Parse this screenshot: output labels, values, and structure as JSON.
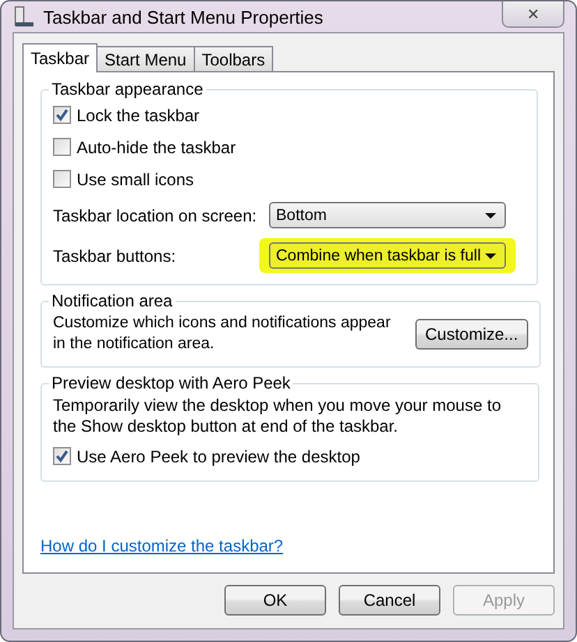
{
  "window": {
    "title": "Taskbar and Start Menu Properties",
    "close": "✕"
  },
  "tabs": [
    {
      "label": "Taskbar",
      "selected": true
    },
    {
      "label": "Start Menu",
      "selected": false
    },
    {
      "label": "Toolbars",
      "selected": false
    }
  ],
  "appearance": {
    "title": "Taskbar appearance",
    "checkboxes": [
      {
        "label": "Lock the taskbar",
        "checked": true
      },
      {
        "label": "Auto-hide the taskbar",
        "checked": false
      },
      {
        "label": "Use small icons",
        "checked": false
      }
    ],
    "dropdowns": [
      {
        "label": "Taskbar location on screen:",
        "value": "Bottom",
        "highlighted": false
      },
      {
        "label": "Taskbar buttons:",
        "value": "Combine when taskbar is full",
        "highlighted": true
      }
    ]
  },
  "notification": {
    "title": "Notification area",
    "text": "Customize which icons and notifications appear in the notification area.",
    "button": "Customize..."
  },
  "preview": {
    "title": "Preview desktop with Aero Peek",
    "text": "Temporarily view the desktop when you move your mouse to the Show desktop button at end of the taskbar.",
    "checkbox": {
      "label": "Use Aero Peek to preview the desktop",
      "checked": true
    }
  },
  "link": "How do I customize the taskbar?",
  "buttons": [
    {
      "label": "OK",
      "disabled": false
    },
    {
      "label": "Cancel",
      "disabled": false
    },
    {
      "label": "Apply",
      "disabled": true
    }
  ]
}
